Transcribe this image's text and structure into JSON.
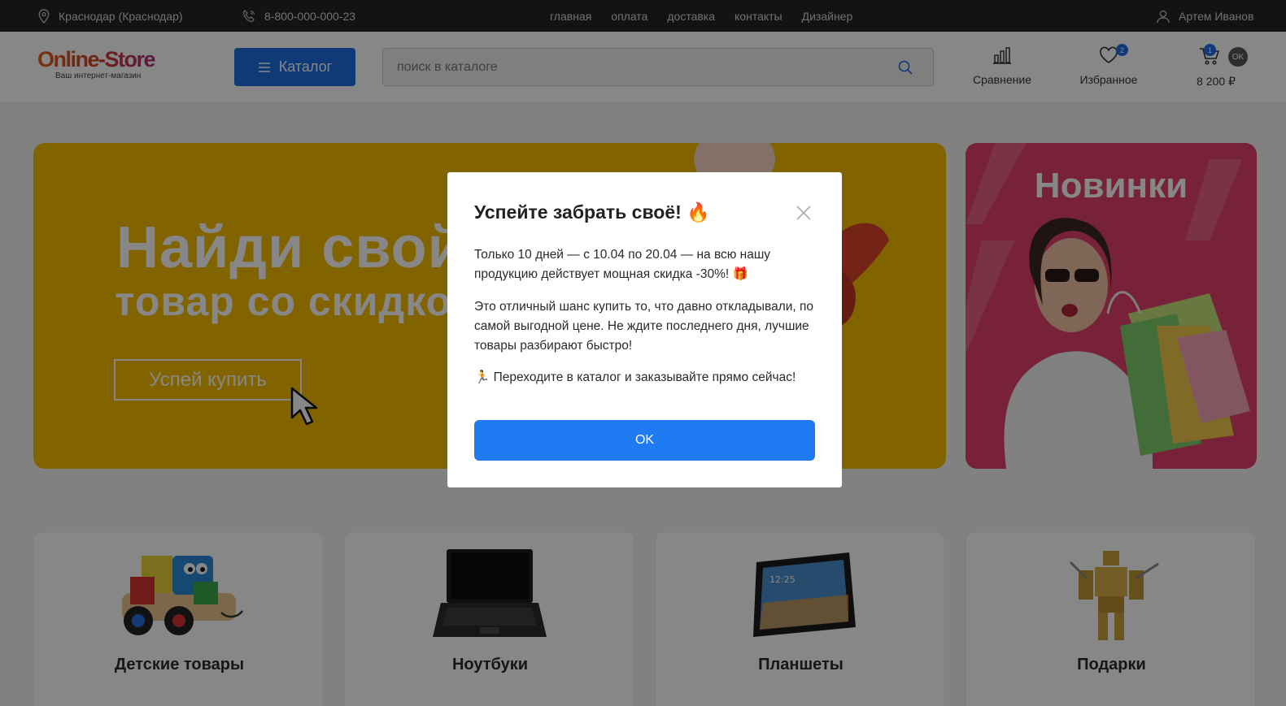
{
  "topbar": {
    "city": "Краснодар (Краснодар)",
    "phone": "8-800-000-000-23",
    "nav": [
      "главная",
      "оплата",
      "доставка",
      "контакты",
      "Дизайнер"
    ],
    "user": "Артем Иванов"
  },
  "header": {
    "logo_name": "Online-Store",
    "logo_tagline": "Ваш интернет-магазин",
    "catalog_label": "Каталог",
    "search_placeholder": "поиск в каталоге",
    "compare_label": "Сравнение",
    "favorites_label": "Избранное",
    "favorites_count": "2",
    "cart_count": "1",
    "cart_total": "8 200 ₽",
    "cart_ok": "OK"
  },
  "banner_main": {
    "headline": "Найди свой",
    "subline": "товар со скидкой",
    "cta_label": "Успей купить"
  },
  "banner_side": {
    "title": "Новинки"
  },
  "categories": [
    {
      "title": "Детские товары"
    },
    {
      "title": "Ноутбуки"
    },
    {
      "title": "Планшеты"
    },
    {
      "title": "Подарки"
    }
  ],
  "modal": {
    "title": "Успейте забрать своё! 🔥",
    "p1": "Только 10 дней — с 10.04 по 20.04 — на всю нашу продукцию действует мощная скидка -30%! 🎁",
    "p2": "Это отличный шанс купить то, что давно откладывали, по самой выгодной цене. Не ждите последнего дня, лучшие товары разбирают быстро!",
    "p3": "🏃 Переходите в каталог и заказывайте прямо сейчас!",
    "ok_label": "OK"
  },
  "colors": {
    "accent": "#1e6fe0",
    "ok_button": "#1f7bf2",
    "banner_yellow": "#f3bd00",
    "banner_pink": "#e0406a",
    "topbar": "#242424"
  }
}
